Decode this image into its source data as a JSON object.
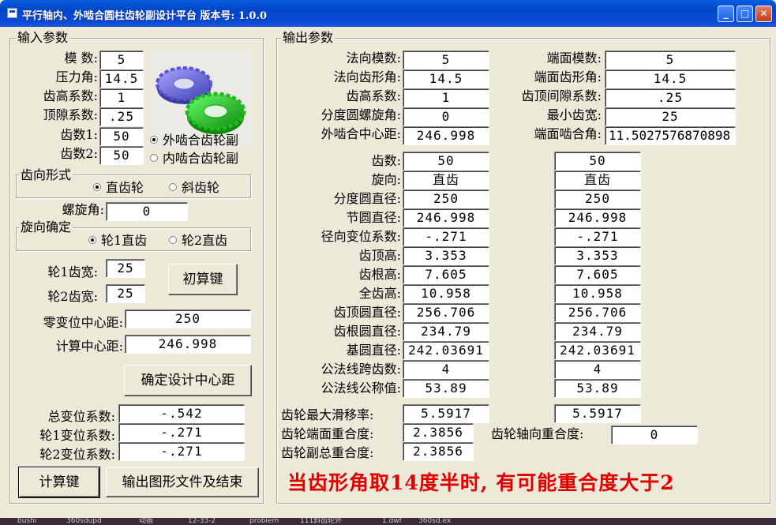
{
  "window": {
    "title": "平行轴内、外啮合圆柱齿轮副设计平台 版本号: 1.0.0",
    "minimize": "_",
    "maximize": "□",
    "close": "✕"
  },
  "input": {
    "legend": "输入参数",
    "module_label": "模  数:",
    "module_value": "5",
    "pressure_angle_label": "压力角:",
    "pressure_angle_value": "14.5",
    "addendum_coef_label": "齿高系数:",
    "addendum_coef_value": "1",
    "clearance_coef_label": "顶隙系数:",
    "clearance_coef_value": ".25",
    "teeth1_label": "齿数1:",
    "teeth1_value": "50",
    "teeth2_label": "齿数2:",
    "teeth2_value": "50",
    "mesh_external": "外啮合齿轮副",
    "mesh_internal": "内啮合齿轮副",
    "tooth_form_legend": "齿向形式",
    "spur_option": "直齿轮",
    "helical_option": "斜齿轮",
    "helix_angle_label": "螺旋角:",
    "helix_angle_value": "0",
    "direction_legend": "旋向确定",
    "dir_gear1": "轮1直齿",
    "dir_gear2": "轮2直齿",
    "face_width1_label": "轮1齿宽:",
    "face_width1_value": "25",
    "face_width2_label": "轮2齿宽:",
    "face_width2_value": "25",
    "initial_calc_button": "初算键",
    "zero_shift_center_label": "零变位中心距:",
    "zero_shift_center_value": "250",
    "calc_center_label": "计算中心距:",
    "calc_center_value": "246.998",
    "confirm_center_button": "确定设计中心距",
    "total_shift_label": "总变位系数:",
    "total_shift_value": "-.542",
    "shift1_label": "轮1变位系数:",
    "shift1_value": "-.271",
    "shift2_label": "轮2变位系数:",
    "shift2_value": "-.271",
    "calc_button": "计算键",
    "export_button": "输出图形文件及结束"
  },
  "output": {
    "legend": "输出参数",
    "normal_module_label": "法向模数:",
    "normal_module_value": "5",
    "normal_pressure_label": "法向齿形角:",
    "normal_pressure_value": "14.5",
    "addendum_label": "齿高系数:",
    "addendum_value": "1",
    "helix_label": "分度圆螺旋角:",
    "helix_value": "0",
    "ext_center_label": "外啮合中心距:",
    "ext_center_value": "246.998",
    "trans_module_label": "端面模数:",
    "trans_module_value": "5",
    "trans_pressure_label": "端面齿形角:",
    "trans_pressure_value": "14.5",
    "tip_clearance_label": "齿顶间隙系数:",
    "tip_clearance_value": ".25",
    "min_width_label": "最小齿宽:",
    "min_width_value": "25",
    "trans_mesh_angle_label": "端面啮合角:",
    "trans_mesh_angle_value": "11.5027576870898",
    "rows": [
      {
        "label": "齿数:",
        "g1": "50",
        "g2": "50"
      },
      {
        "label": "旋向:",
        "g1": "直齿",
        "g2": "直齿"
      },
      {
        "label": "分度圆直径:",
        "g1": "250",
        "g2": "250"
      },
      {
        "label": "节圆直径:",
        "g1": "246.998",
        "g2": "246.998"
      },
      {
        "label": "径向变位系数:",
        "g1": "-.271",
        "g2": "-.271"
      },
      {
        "label": "齿顶高:",
        "g1": "3.353",
        "g2": "3.353"
      },
      {
        "label": "齿根高:",
        "g1": "7.605",
        "g2": "7.605"
      },
      {
        "label": "全齿高:",
        "g1": "10.958",
        "g2": "10.958"
      },
      {
        "label": "齿顶圆直径:",
        "g1": "256.706",
        "g2": "256.706"
      },
      {
        "label": "齿根圆直径:",
        "g1": "234.79",
        "g2": "234.79"
      },
      {
        "label": "基圆直径:",
        "g1": "242.03691",
        "g2": "242.03691"
      },
      {
        "label": "公法线跨齿数:",
        "g1": "4",
        "g2": "4"
      },
      {
        "label": "公法线公称值:",
        "g1": "53.89",
        "g2": "53.89"
      }
    ],
    "max_slip_label": "齿轮最大滑移率:",
    "max_slip_g1": "5.5917",
    "max_slip_g2": "5.5917",
    "trans_contact_label": "齿轮端面重合度:",
    "trans_contact_value": "2.3856",
    "axial_contact_label": "齿轮轴向重合度:",
    "axial_contact_value": "0",
    "total_contact_label": "齿轮副总重合度:",
    "total_contact_value": "2.3856",
    "warning": "当齿形角取14度半时, 有可能重合度大于2"
  },
  "taskbar": {
    "items": [
      "bushi",
      "360sdupd",
      "动画",
      "12-33-2",
      "problem",
      "111斜齿轮外",
      "1.dwf",
      "360sd.ex"
    ]
  },
  "colors": {
    "gear_blue": "#6a6ae6",
    "gear_green": "#22cc22",
    "warning_red": "#e00000",
    "titlebar_blue": "#0a4ad6"
  }
}
